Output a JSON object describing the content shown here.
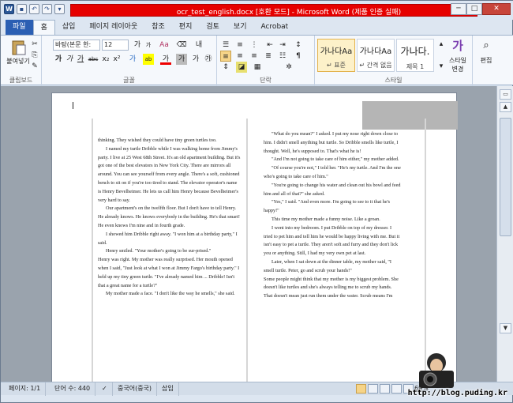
{
  "window": {
    "title": "ocr_test_english.docx [호환 모드] - Microsoft Word (제품 인증 실패)",
    "controls": {
      "minimize": "─",
      "maximize": "□",
      "close": "✕"
    }
  },
  "qat": {
    "word_logo": "W",
    "save": "▪",
    "undo": "↶",
    "redo": "↷",
    "customize": "▾"
  },
  "tabs": [
    "파일",
    "홈",
    "삽입",
    "페이지 레이아웃",
    "참조",
    "편지",
    "검토",
    "보기",
    "Acrobat"
  ],
  "ribbon": {
    "clipboard": {
      "label": "클립보드",
      "paste": "붙여넣기"
    },
    "font": {
      "label": "글꼴",
      "family": "바탕(본문 한:",
      "size": "12",
      "grow": "가",
      "shrink": "가",
      "clear": "Aa",
      "bold": "가",
      "italic": "가",
      "underline": "가",
      "strike": "abc",
      "sub": "x₂",
      "sup": "x²",
      "effects": "가",
      "highlight": "ab",
      "color": "가",
      "charshade": "가",
      "phonetic": "가",
      "enclose": "㉮"
    },
    "paragraph": {
      "label": "단락"
    },
    "styles": {
      "label": "스타일",
      "items": [
        {
          "sample": "가나다Aa",
          "name": "↵ 표준"
        },
        {
          "sample": "가나다Aa",
          "name": "↵ 간격 없음"
        },
        {
          "sample": "가나다.",
          "name": "제목 1"
        }
      ],
      "change": "스타일 변경",
      "change_icon": "가"
    },
    "editing": {
      "label": "편집"
    }
  },
  "document": {
    "col1": [
      {
        "t": "thinking. They wished they could have tiny green turtles too.",
        "i": false
      },
      {
        "t": "I named my turtle Dribble while I was walking home from Jimmy's party. I live at 25 West 68th Street. It's an old apartment building. But it's got one of the best elevators in New York City. There are mirrors all around. You can see yourself from every angle. There's a soft, cushioned bench to sit on if you're too tired to stand. The elevator operator's name is Henry Bevelheimer. He lets us call him Henry because Bevelheimer's very hard to say.",
        "i": true
      },
      {
        "t": "Our apartment's on the twelfth floor. But I don't have to tell Henry. He already knows. He knows everybody in the building. He's that smart! He even knows I'm nine and in fourth grade.",
        "i": true
      },
      {
        "t": "I showed him Dribble right away. \"I won him at a birthday party,\" I said.",
        "i": true
      },
      {
        "t": "Henry smiled. \"Your mother's going to be sur-prised.\"",
        "i": true
      },
      {
        "t": "Henry was right. My mother was really surprised. Her mouth opened when I said, \"Just look at what I won at Jimmy Fargo's birthday party.\" I held up my tiny green turtle. \"I've already named him ... Dribble! Isn't that a great name for a turtle?\"",
        "i": false
      },
      {
        "t": "My mother made a face. \"I don't like the way he smells,\" she said.",
        "i": true
      }
    ],
    "col2": [
      {
        "t": "\"What do you mean?\" I asked. I put my nose right down close to him. I didn't smell anything but turtle. So Dribble smells like turtle, I thought. Well, he's supposed to. That's what he is!",
        "i": true
      },
      {
        "t": "\"And I'm not going to take care of him either,\" my mother added.",
        "i": true
      },
      {
        "t": "\"Of course you're not,\" I told her. \"He's my turtle. And I'm the one who's going to take care of him.\"",
        "i": true
      },
      {
        "t": "\"You're going to change his water and clean out his bowl and feed him and all of that?\" she asked.",
        "i": true
      },
      {
        "t": "\"Yes,\" I said. \"And even more. I'm going to see to it that he's happy!\"",
        "i": true
      },
      {
        "t": "This time my mother made a funny noise. Like a groan.",
        "i": true
      },
      {
        "t": "I went into my bedroom. I put Dribble on top of my dresser. I tried to pet him and tell him he would be happy living with me. But it isn't easy to pet a turtle. They aren't soft and furry and they don't lick you or anything. Still, I had my very own pet at last.",
        "i": true
      },
      {
        "t": "Later, when I sat down at the dinner table, my mother said, \"I smell turtle. Peter, go and scrub your hands!\"",
        "i": true
      },
      {
        "t": "Some people might think that my mother is my biggest problem. She doesn't like turtles and she's always telling me to scrub my hands. That doesn't mean just run them under the water. Scrub means I'm",
        "i": false
      }
    ]
  },
  "status": {
    "page": "페이지: 1/1",
    "words": "단어 수: 440",
    "lang": "중국어(중국)",
    "mode": "삽입",
    "zoom": "69%"
  },
  "watermark": {
    "text": "http://blog.puding.kr"
  }
}
